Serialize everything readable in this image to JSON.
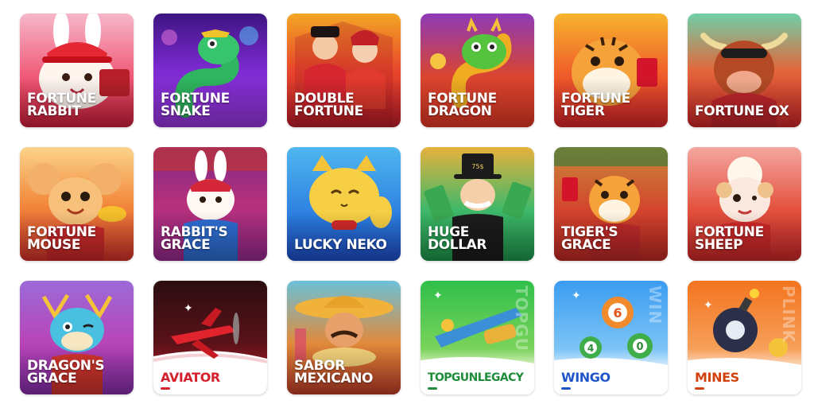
{
  "games": [
    {
      "id": "fortune-rabbit",
      "label": "FORTUNE\nRABBIT"
    },
    {
      "id": "fortune-snake",
      "label": "FORTUNE\nSNAKE"
    },
    {
      "id": "double-fortune",
      "label": "DOUBLE\nFORTUNE"
    },
    {
      "id": "fortune-dragon",
      "label": "FORTUNE\nDRAGON"
    },
    {
      "id": "fortune-tiger",
      "label": "FORTUNE\nTIGER"
    },
    {
      "id": "fortune-ox",
      "label": "FORTUNE OX"
    },
    {
      "id": "fortune-mouse",
      "label": "FORTUNE\nMOUSE"
    },
    {
      "id": "rabbits-grace",
      "label": "RABBIT'S\nGRACE"
    },
    {
      "id": "lucky-neko",
      "label": "LUCKY NEKO"
    },
    {
      "id": "huge-dollar",
      "label": "HUGE\nDOLLAR"
    },
    {
      "id": "tigers-grace",
      "label": "TIGER'S\nGRACE"
    },
    {
      "id": "fortune-sheep",
      "label": "FORTUNE\nSHEEP"
    },
    {
      "id": "dragons-grace",
      "label": "DRAGON'S\nGRACE"
    },
    {
      "id": "aviator",
      "label": "AVIATOR",
      "accent": "#d4212c"
    },
    {
      "id": "sabor-mexicano",
      "label": "SABOR\nMEXICANO"
    },
    {
      "id": "topgunlegacy",
      "label": "TOPGUNLEGACY",
      "accent": "#1f8c3a"
    },
    {
      "id": "wingo",
      "label": "WINGO",
      "accent": "#1f55c8"
    },
    {
      "id": "mines",
      "label": "MINES",
      "accent": "#d2420e"
    }
  ],
  "watermarks": {
    "topgunlegacy": "TOPGU",
    "wingo": "WIN",
    "mines": "PLINK"
  },
  "wingo_balls": [
    "6",
    "4",
    "0"
  ],
  "topbadge": "TOP",
  "dollar_hat": "75$"
}
